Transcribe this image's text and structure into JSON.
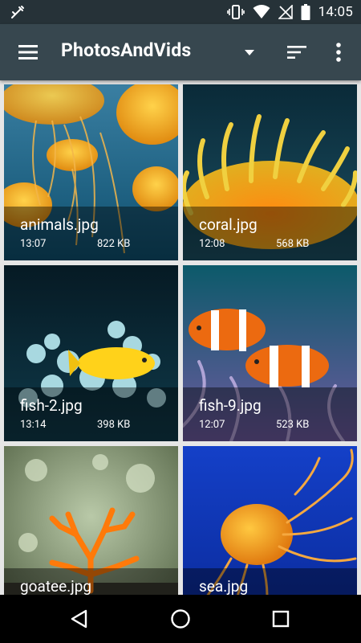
{
  "status_bar": {
    "time": "14:05",
    "icons": [
      "debug-icon",
      "vibrate-icon",
      "wifi-icon",
      "no-signal-icon",
      "battery-icon"
    ]
  },
  "app_bar": {
    "title": "PhotosAndVids",
    "icons": [
      "menu-icon",
      "dropdown-arrow-icon",
      "sort-icon",
      "more-vert-icon"
    ],
    "color": "#37474f"
  },
  "gallery": {
    "items": [
      {
        "name": "animals.jpg",
        "time": "13:07",
        "size": "822 KB"
      },
      {
        "name": "coral.jpg",
        "time": "12:08",
        "size": "568 KB"
      },
      {
        "name": "fish-2.jpg",
        "time": "13:14",
        "size": "398 KB"
      },
      {
        "name": "fish-9.jpg",
        "time": "12:07",
        "size": "523 KB"
      },
      {
        "name": "goatee.jpg",
        "time": "",
        "size": ""
      },
      {
        "name": "sea.jpg",
        "time": "",
        "size": ""
      }
    ]
  },
  "nav_bar": {
    "icons": [
      "back-icon",
      "home-icon",
      "recents-icon"
    ]
  }
}
